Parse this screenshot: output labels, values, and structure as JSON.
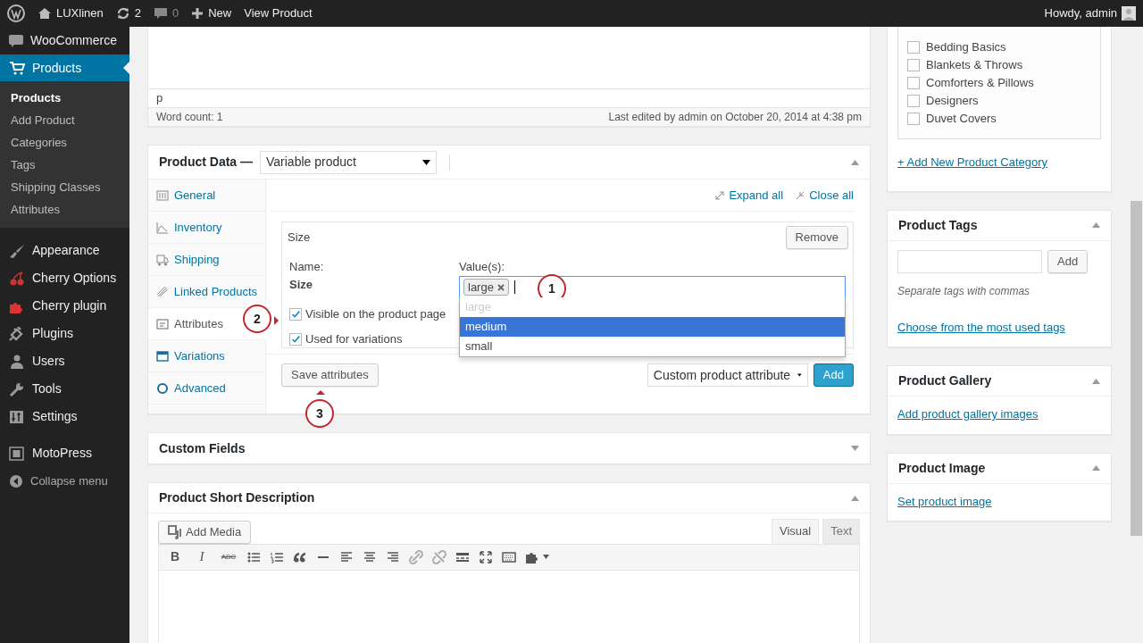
{
  "admin_bar": {
    "site_name": "LUXlinen",
    "updates": "2",
    "comments": "0",
    "new_label": "New",
    "view_label": "View Product",
    "greeting": "Howdy, admin"
  },
  "sidebar": {
    "items": [
      {
        "label": "WooCommerce",
        "selected": false
      },
      {
        "label": "Products",
        "selected": true,
        "children": [
          {
            "label": "Products",
            "selected": true
          },
          {
            "label": "Add Product",
            "selected": false
          },
          {
            "label": "Categories",
            "selected": false
          },
          {
            "label": "Tags",
            "selected": false
          },
          {
            "label": "Shipping Classes",
            "selected": false
          },
          {
            "label": "Attributes",
            "selected": false
          }
        ]
      },
      {
        "label": "Appearance",
        "selected": false
      },
      {
        "label": "Cherry Options",
        "selected": false
      },
      {
        "label": "Cherry plugin",
        "selected": false
      },
      {
        "label": "Plugins",
        "selected": false
      },
      {
        "label": "Users",
        "selected": false
      },
      {
        "label": "Tools",
        "selected": false
      },
      {
        "label": "Settings",
        "selected": false
      },
      {
        "label": "MotoPress",
        "selected": false
      }
    ],
    "collapse_label": "Collapse menu"
  },
  "editor": {
    "path": "p",
    "word_count": "Word count: 1",
    "last_edited": "Last edited by admin on October 20, 2014 at 4:38 pm"
  },
  "product_data": {
    "title": "Product Data —",
    "expanded": true,
    "type_select": "Variable product",
    "tabs": [
      {
        "label": "General",
        "selected": false
      },
      {
        "label": "Inventory",
        "selected": false
      },
      {
        "label": "Shipping",
        "selected": false
      },
      {
        "label": "Linked Products",
        "selected": false
      },
      {
        "label": "Attributes",
        "selected": true
      },
      {
        "label": "Variations",
        "selected": false
      },
      {
        "label": "Advanced",
        "selected": false
      }
    ],
    "expand_all": "Expand all",
    "close_all": "Close all",
    "attribute": {
      "title": "Size",
      "remove_label": "Remove",
      "name_label": "Name:",
      "name_value": "Size",
      "values_label": "Value(s):",
      "tokens": [
        "large"
      ],
      "options": [
        {
          "label": "large",
          "disabled": true,
          "selected": false
        },
        {
          "label": "medium",
          "disabled": false,
          "selected": true
        },
        {
          "label": "small",
          "disabled": false,
          "selected": false
        }
      ],
      "checkboxes": [
        {
          "label": "Visible on the product page",
          "checked": true
        },
        {
          "label": "Used for variations",
          "checked": true
        }
      ]
    },
    "save_label": "Save attributes",
    "attribute_select": "Custom product attribute",
    "add_label": "Add"
  },
  "callouts": [
    "1",
    "2",
    "3"
  ],
  "custom_fields": {
    "title": "Custom Fields",
    "expanded": false
  },
  "short_description": {
    "title": "Product Short Description",
    "expanded": true,
    "add_media": "Add Media",
    "tabs": [
      {
        "label": "Visual",
        "selected": true
      },
      {
        "label": "Text",
        "selected": false
      }
    ],
    "toolbar_text": [
      "B",
      "I",
      "ABC"
    ]
  },
  "categories": {
    "items": [
      {
        "label": "Bedding Basics",
        "checked": false
      },
      {
        "label": "Blankets & Throws",
        "checked": false
      },
      {
        "label": "Comforters & Pillows",
        "checked": false
      },
      {
        "label": "Designers",
        "checked": false
      },
      {
        "label": "Duvet Covers",
        "checked": false
      }
    ],
    "add_link": "+ Add New Product Category"
  },
  "tags_box": {
    "title": "Product Tags",
    "expanded": true,
    "add_label": "Add",
    "hint": "Separate tags with commas",
    "link": "Choose from the most used tags"
  },
  "gallery": {
    "title": "Product Gallery",
    "expanded": true,
    "link": "Add product gallery images"
  },
  "image_box": {
    "title": "Product Image",
    "expanded": true,
    "link": "Set product image"
  }
}
